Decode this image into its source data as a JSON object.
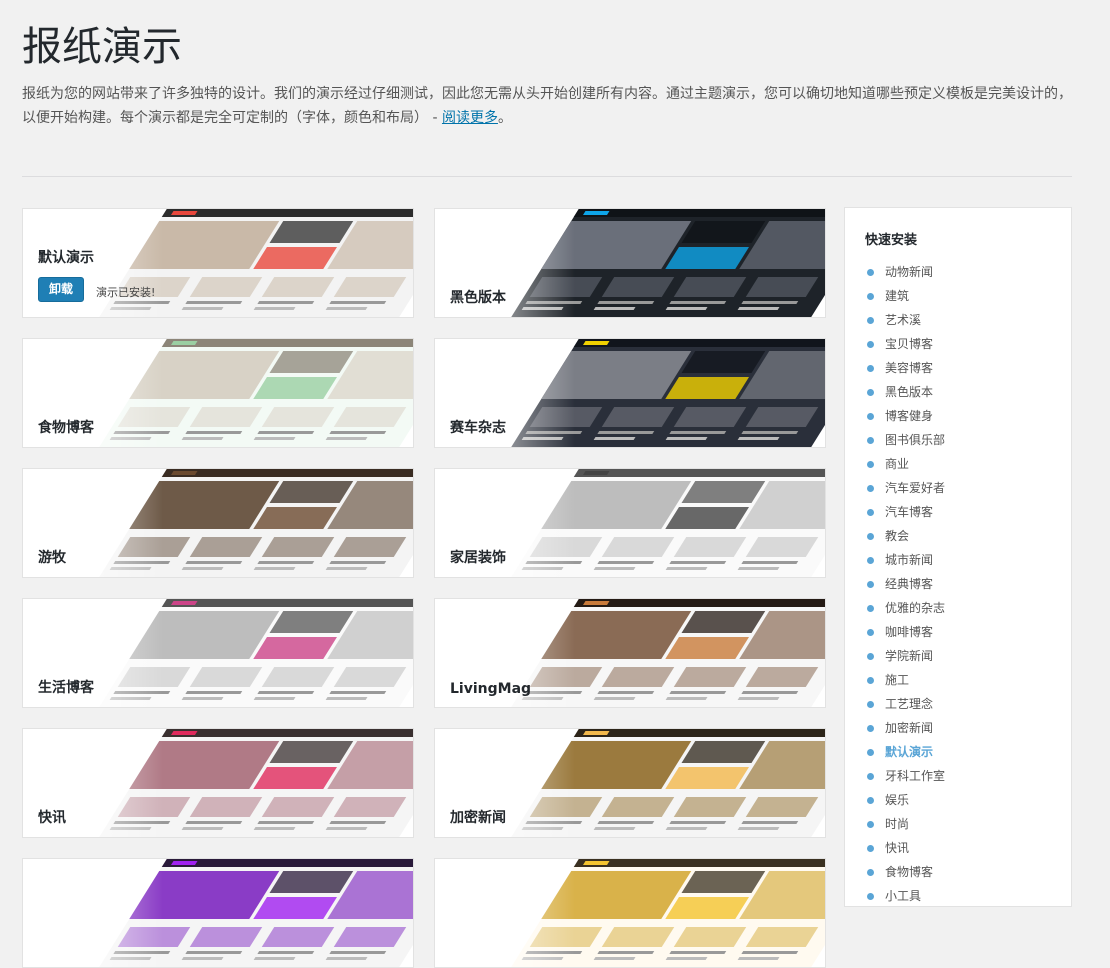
{
  "page": {
    "title": "报纸演示",
    "intro": "报纸为您的网站带来了许多独特的设计。我们的演示经过仔细测试，因此您无需从头开始创建所有内容。通过主题演示，您可以确切地知道哪些预定义模板是完美设计的，以便开始构建。每个演示都是完全可定制的（字体，颜色和布局） - ",
    "read_more": "阅读更多",
    "intro_end": "。"
  },
  "colors": {
    "accent": "#1f7fb5",
    "link": "#0073aa",
    "bullet": "#5aa5d6",
    "background": "#f1f1f1"
  },
  "demos": [
    {
      "name": "默认演示",
      "installed": true,
      "uninstall_label": "卸载",
      "installed_note": "演示已安装!",
      "theme": "light",
      "accent": "#e8473c"
    },
    {
      "name": "黑色版本",
      "theme": "dark",
      "accent": "#0ea5e9"
    },
    {
      "name": "食物博客",
      "theme": "soft",
      "accent": "#9acfa2"
    },
    {
      "name": "赛车杂志",
      "theme": "dark2",
      "accent": "#f1d100"
    },
    {
      "name": "游牧",
      "theme": "travel",
      "accent": "#6b4a2f"
    },
    {
      "name": "家居装饰",
      "theme": "white",
      "accent": "#444444"
    },
    {
      "name": "生活博客",
      "theme": "white",
      "accent": "#c48"
    },
    {
      "name": "LivingMag",
      "theme": "mag",
      "accent": "#c87a3a"
    },
    {
      "name": "快讯",
      "theme": "news",
      "accent": "#e02a5d"
    },
    {
      "name": "加密新闻",
      "theme": "crypto",
      "accent": "#f2b84b"
    },
    {
      "name": "",
      "theme": "purple",
      "accent": "#a020f0"
    },
    {
      "name": "",
      "theme": "yellow",
      "accent": "#f4c430"
    }
  ],
  "sidebar": {
    "title": "快速安装",
    "items": [
      "动物新闻",
      "建筑",
      "艺术溪",
      "宝贝博客",
      "美容博客",
      "黑色版本",
      "博客健身",
      "图书俱乐部",
      "商业",
      "汽车爱好者",
      "汽车博客",
      "教会",
      "城市新闻",
      "经典博客",
      "优雅的杂志",
      "咖啡博客",
      "学院新闻",
      "施工",
      "工艺理念",
      "加密新闻",
      "默认演示",
      "牙科工作室",
      "娱乐",
      "时尚",
      "快讯",
      "食物博客",
      "小工具"
    ],
    "active": "默认演示"
  }
}
